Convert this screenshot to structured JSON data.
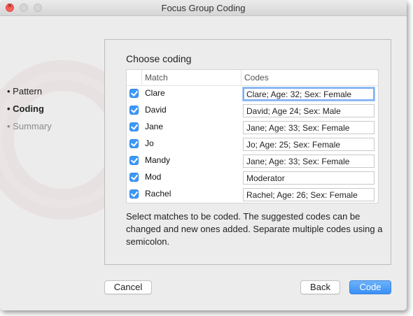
{
  "window": {
    "title": "Focus Group Coding"
  },
  "steps": [
    {
      "label": "Pattern",
      "state": "done"
    },
    {
      "label": "Coding",
      "state": "active"
    },
    {
      "label": "Summary",
      "state": "disabled"
    }
  ],
  "panel": {
    "heading": "Choose coding",
    "columns": {
      "match": "Match",
      "codes": "Codes"
    },
    "rows": [
      {
        "match": "Clare",
        "code": "Clare; Age: 32; Sex: Female",
        "checked": true
      },
      {
        "match": "David",
        "code": "David; Age 24; Sex: Male",
        "checked": true
      },
      {
        "match": "Jane",
        "code": "Jane; Age: 33; Sex: Female",
        "checked": true
      },
      {
        "match": "Jo",
        "code": "Jo; Age: 25; Sex: Female",
        "checked": true
      },
      {
        "match": "Mandy",
        "code": "Jane; Age: 33; Sex: Female",
        "checked": true
      },
      {
        "match": "Mod",
        "code": "Moderator",
        "checked": true
      },
      {
        "match": "Rachel",
        "code": "Rachel; Age: 26; Sex: Female",
        "checked": true
      }
    ],
    "help": "Select matches to be coded. The suggested codes can be changed and new ones added. Separate multiple codes using a semicolon."
  },
  "buttons": {
    "cancel": "Cancel",
    "back": "Back",
    "code": "Code"
  },
  "colors": {
    "accent": "#3b99fc",
    "close": "#fc605c"
  }
}
